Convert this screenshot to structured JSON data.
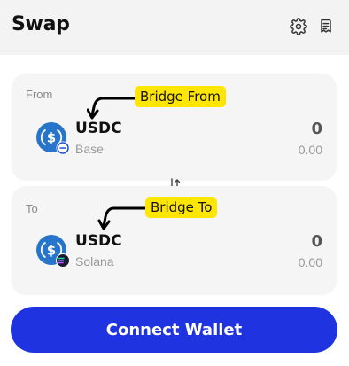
{
  "header": {
    "title": "Swap",
    "settings_icon": "gear-icon",
    "history_icon": "receipt-icon"
  },
  "from": {
    "label": "From",
    "token_symbol": "USDC",
    "chain_name": "Base",
    "amount": "0",
    "usd_value": "0.00",
    "token_icon": "usdc-icon",
    "chain_icon": "base-chain-icon"
  },
  "to": {
    "label": "To",
    "token_symbol": "USDC",
    "chain_name": "Solana",
    "amount": "0",
    "usd_value": "0.00",
    "token_icon": "usdc-icon",
    "chain_icon": "solana-chain-icon"
  },
  "switch_icon": "swap-arrows-icon",
  "annotations": {
    "bridge_from": "Bridge From",
    "bridge_to": "Bridge To"
  },
  "connect_button_label": "Connect Wallet",
  "colors": {
    "primary_button": "#1f33e0",
    "card_bg": "#f5f5f6",
    "usdc_blue": "#2775ca",
    "annotation_yellow": "#ffe600"
  }
}
